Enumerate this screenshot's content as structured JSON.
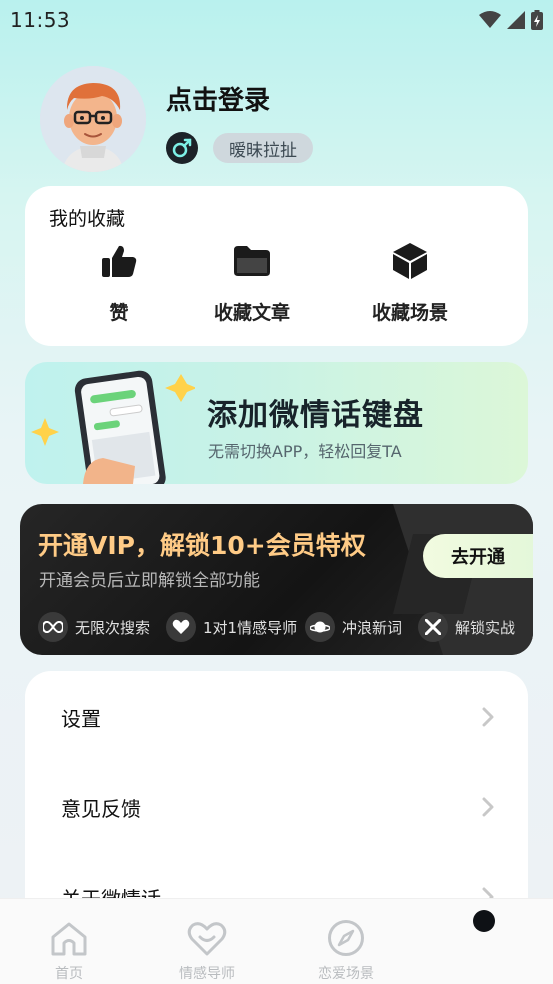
{
  "status": {
    "time": "11:53"
  },
  "profile": {
    "title": "点击登录",
    "tag": "暧昧拉扯"
  },
  "favorites": {
    "title": "我的收藏",
    "items": [
      {
        "label": "赞",
        "icon": "thumbs-up-icon"
      },
      {
        "label": "收藏文章",
        "icon": "folder-icon"
      },
      {
        "label": "收藏场景",
        "icon": "cube-icon"
      }
    ]
  },
  "keyboard_banner": {
    "title": "添加微情话键盘",
    "subtitle": "无需切换APP，轻松回复TA"
  },
  "vip": {
    "title": "开通VIP，解锁10+会员特权",
    "subtitle": "开通会员后立即解锁全部功能",
    "button": "去开通",
    "perks": [
      {
        "label": "无限次搜索",
        "icon": "infinity-icon"
      },
      {
        "label": "1对1情感导师",
        "icon": "hearts-icon"
      },
      {
        "label": "冲浪新词",
        "icon": "planet-icon"
      },
      {
        "label": "解锁实战",
        "icon": "unlock-icon"
      }
    ]
  },
  "menu": {
    "items": [
      {
        "label": "设置"
      },
      {
        "label": "意见反馈"
      },
      {
        "label": "关于微情话"
      }
    ]
  },
  "tabbar": {
    "items": [
      {
        "label": "首页",
        "icon": "home-icon"
      },
      {
        "label": "情感导师",
        "icon": "heart-icon"
      },
      {
        "label": "恋爱场景",
        "icon": "compass-icon"
      },
      {
        "label": "",
        "icon": "dot-icon"
      }
    ]
  },
  "colors": {
    "accent_vip": "#ffcb86",
    "tab_inactive": "#b9bcbf",
    "tag_bg": "#cfd8dd"
  }
}
